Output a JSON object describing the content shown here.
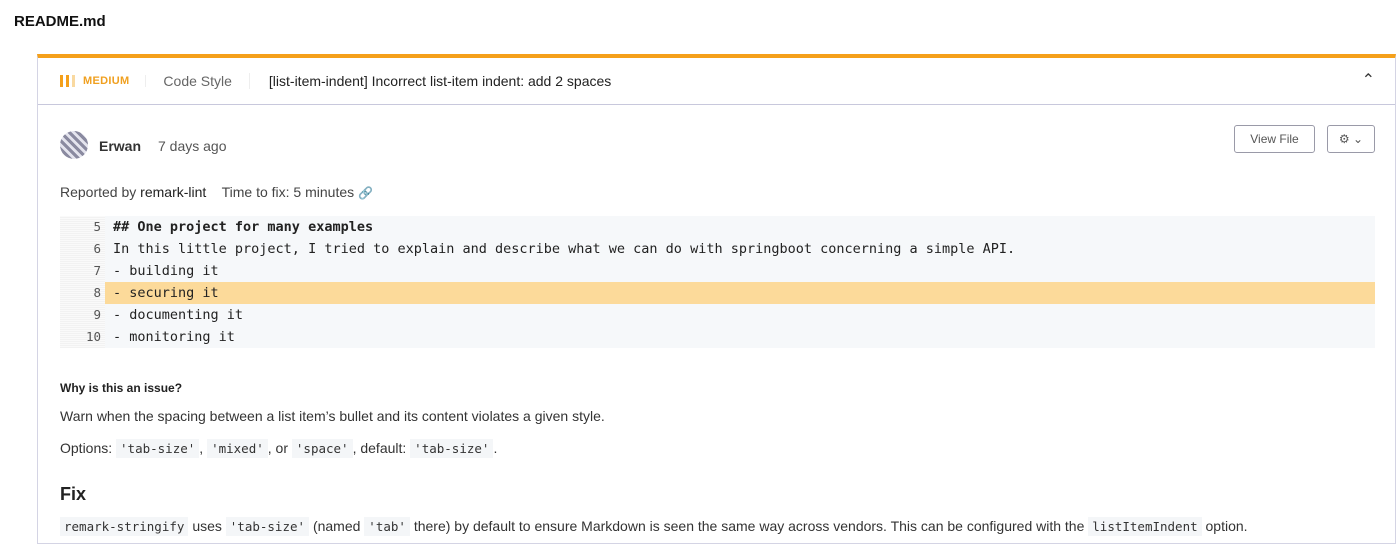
{
  "file_name": "README.md",
  "issue": {
    "severity": "MEDIUM",
    "category": "Code Style",
    "title": "[list-item-indent] Incorrect list-item indent: add 2 spaces",
    "accent_color": "#f5a01a"
  },
  "author": {
    "name": "Erwan",
    "time": "7 days ago"
  },
  "buttons": {
    "view_file": "View File",
    "gear": "⚙ ⌄"
  },
  "reported": {
    "prefix": "Reported by",
    "tool": "remark-lint",
    "time_to_fix": "Time to fix: 5 minutes",
    "link_icon": "🔗"
  },
  "code_lines": [
    {
      "num": "5",
      "text": "## One project for many examples"
    },
    {
      "num": "6",
      "text": "In this little project, I tried to explain and describe what we can do with springboot concerning a simple API."
    },
    {
      "num": "7",
      "text": "- building it"
    },
    {
      "num": "8",
      "text": "- securing it"
    },
    {
      "num": "9",
      "text": "- documenting it"
    },
    {
      "num": "10",
      "text": "- monitoring it"
    }
  ],
  "why": {
    "heading": "Why is this an issue?",
    "text": "Warn when the spacing between a list item’s bullet and its content violates a given style.",
    "options": {
      "prefix": "Options:",
      "o1": "'tab-size'",
      "sep1": ",",
      "o2": "'mixed'",
      "sep2": ", or",
      "o3": "'space'",
      "sep3": ", default:",
      "o4": "'tab-size'",
      "end": "."
    }
  },
  "fix": {
    "heading": "Fix",
    "c1": "remark-stringify",
    "t1": "uses",
    "c2": "'tab-size'",
    "t2": "(named",
    "c3": "'tab'",
    "t3": "there) by default to ensure Markdown is seen the same way across vendors. This can be configured with the",
    "c4": "listItemIndent",
    "t4": "option."
  }
}
